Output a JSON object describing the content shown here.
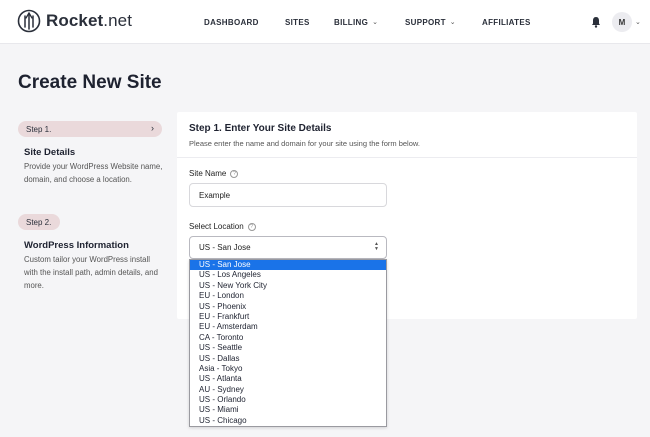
{
  "brand": {
    "name_bold": "Rocket",
    "name_rest": ".net"
  },
  "nav": [
    {
      "label": "DASHBOARD",
      "has_caret": false
    },
    {
      "label": "SITES",
      "has_caret": false
    },
    {
      "label": "BILLING",
      "has_caret": true
    },
    {
      "label": "SUPPORT",
      "has_caret": true
    },
    {
      "label": "AFFILIATES",
      "has_caret": false
    }
  ],
  "user": {
    "initial": "M"
  },
  "page_title": "Create New Site",
  "steps": [
    {
      "pill": "Step 1.",
      "title": "Site Details",
      "desc": "Provide your WordPress Website name, domain, and choose a location."
    },
    {
      "pill": "Step 2.",
      "title": "WordPress Information",
      "desc": "Custom tailor your WordPress install with the install path, admin details, and more."
    }
  ],
  "form": {
    "title": "Step 1. Enter Your Site Details",
    "subtitle": "Please enter the name and domain for your site using the form below.",
    "site_name_label": "Site Name",
    "site_name_value": "Example",
    "location_label": "Select Location",
    "location_value": "US - San Jose"
  },
  "locations": [
    "US - San Jose",
    "US - Los Angeles",
    "US - New York City",
    "EU - London",
    "US - Phoenix",
    "EU - Frankfurt",
    "EU - Amsterdam",
    "CA - Toronto",
    "US - Seattle",
    "US - Dallas",
    "Asia - Tokyo",
    "US - Atlanta",
    "AU - Sydney",
    "US - Orlando",
    "US - Miami",
    "US - Chicago"
  ],
  "selected_location_index": 0,
  "colors": {
    "accent": "#1a73e8",
    "step_pill": "#ead9db",
    "page_bg": "#f5f5f7"
  }
}
